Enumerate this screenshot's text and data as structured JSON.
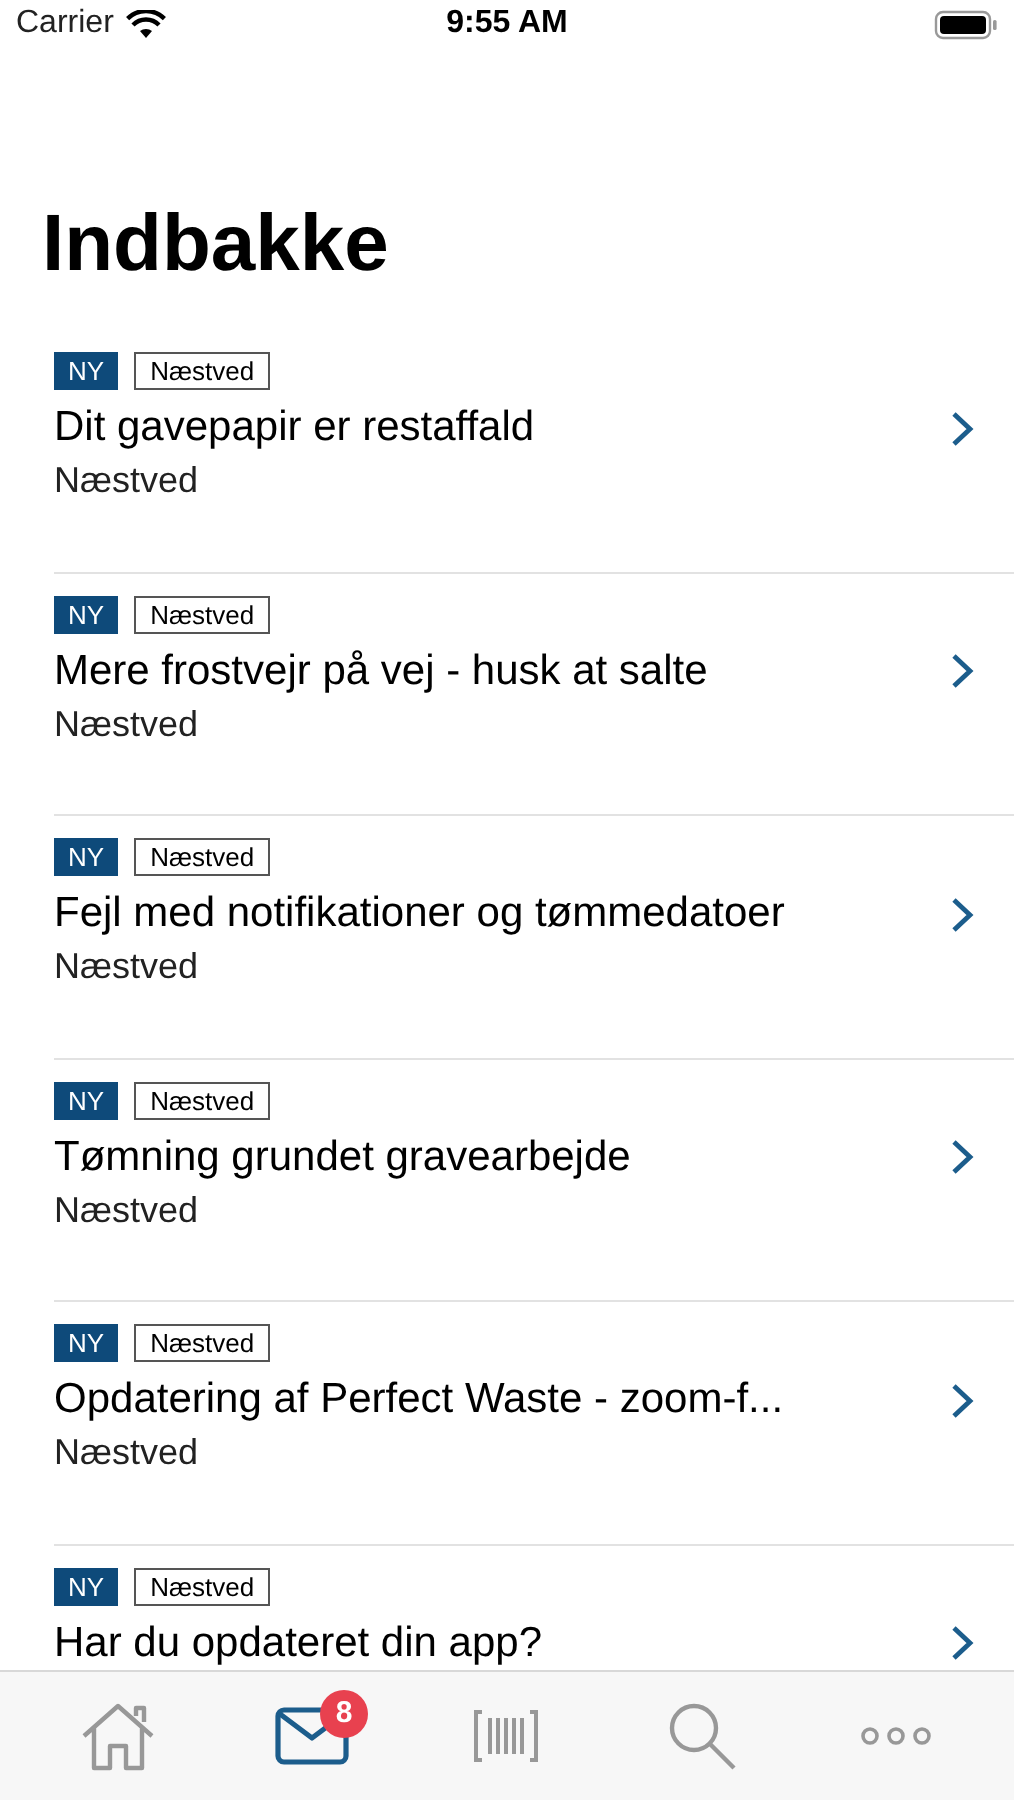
{
  "status_bar": {
    "carrier": "Carrier",
    "time": "9:55 AM"
  },
  "title": "Indbakke",
  "messages": [
    {
      "new_tag": "NY",
      "area_tag": "Næstved",
      "title": "Dit gavepapir er restaffald",
      "subtitle": "Næstved"
    },
    {
      "new_tag": "NY",
      "area_tag": "Næstved",
      "title": "Mere frostvejr på vej - husk at salte",
      "subtitle": "Næstved"
    },
    {
      "new_tag": "NY",
      "area_tag": "Næstved",
      "title": "Fejl med notifikationer og tømmedatoer",
      "subtitle": "Næstved"
    },
    {
      "new_tag": "NY",
      "area_tag": "Næstved",
      "title": "Tømning grundet gravearbejde",
      "subtitle": "Næstved"
    },
    {
      "new_tag": "NY",
      "area_tag": "Næstved",
      "title": "Opdatering af Perfect Waste - zoom-f...",
      "subtitle": "Næstved"
    },
    {
      "new_tag": "NY",
      "area_tag": "Næstved",
      "title": "Har du opdateret din app?"
    }
  ],
  "tab_bar": [
    {
      "kind": "home",
      "selected": false
    },
    {
      "kind": "inbox",
      "selected": true,
      "badge": "8"
    },
    {
      "kind": "barcode",
      "selected": false
    },
    {
      "kind": "search",
      "selected": false
    },
    {
      "kind": "more",
      "selected": false
    }
  ]
}
